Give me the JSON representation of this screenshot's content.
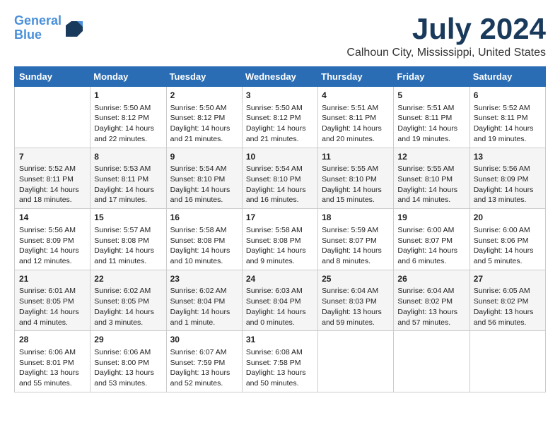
{
  "header": {
    "logo_line1": "General",
    "logo_line2": "Blue",
    "month_title": "July 2024",
    "location": "Calhoun City, Mississippi, United States"
  },
  "weekdays": [
    "Sunday",
    "Monday",
    "Tuesday",
    "Wednesday",
    "Thursday",
    "Friday",
    "Saturday"
  ],
  "weeks": [
    [
      {
        "day": "",
        "sunrise": "",
        "sunset": "",
        "daylight": ""
      },
      {
        "day": "1",
        "sunrise": "Sunrise: 5:50 AM",
        "sunset": "Sunset: 8:12 PM",
        "daylight": "Daylight: 14 hours and 22 minutes."
      },
      {
        "day": "2",
        "sunrise": "Sunrise: 5:50 AM",
        "sunset": "Sunset: 8:12 PM",
        "daylight": "Daylight: 14 hours and 21 minutes."
      },
      {
        "day": "3",
        "sunrise": "Sunrise: 5:50 AM",
        "sunset": "Sunset: 8:12 PM",
        "daylight": "Daylight: 14 hours and 21 minutes."
      },
      {
        "day": "4",
        "sunrise": "Sunrise: 5:51 AM",
        "sunset": "Sunset: 8:11 PM",
        "daylight": "Daylight: 14 hours and 20 minutes."
      },
      {
        "day": "5",
        "sunrise": "Sunrise: 5:51 AM",
        "sunset": "Sunset: 8:11 PM",
        "daylight": "Daylight: 14 hours and 19 minutes."
      },
      {
        "day": "6",
        "sunrise": "Sunrise: 5:52 AM",
        "sunset": "Sunset: 8:11 PM",
        "daylight": "Daylight: 14 hours and 19 minutes."
      }
    ],
    [
      {
        "day": "7",
        "sunrise": "Sunrise: 5:52 AM",
        "sunset": "Sunset: 8:11 PM",
        "daylight": "Daylight: 14 hours and 18 minutes."
      },
      {
        "day": "8",
        "sunrise": "Sunrise: 5:53 AM",
        "sunset": "Sunset: 8:11 PM",
        "daylight": "Daylight: 14 hours and 17 minutes."
      },
      {
        "day": "9",
        "sunrise": "Sunrise: 5:54 AM",
        "sunset": "Sunset: 8:10 PM",
        "daylight": "Daylight: 14 hours and 16 minutes."
      },
      {
        "day": "10",
        "sunrise": "Sunrise: 5:54 AM",
        "sunset": "Sunset: 8:10 PM",
        "daylight": "Daylight: 14 hours and 16 minutes."
      },
      {
        "day": "11",
        "sunrise": "Sunrise: 5:55 AM",
        "sunset": "Sunset: 8:10 PM",
        "daylight": "Daylight: 14 hours and 15 minutes."
      },
      {
        "day": "12",
        "sunrise": "Sunrise: 5:55 AM",
        "sunset": "Sunset: 8:10 PM",
        "daylight": "Daylight: 14 hours and 14 minutes."
      },
      {
        "day": "13",
        "sunrise": "Sunrise: 5:56 AM",
        "sunset": "Sunset: 8:09 PM",
        "daylight": "Daylight: 14 hours and 13 minutes."
      }
    ],
    [
      {
        "day": "14",
        "sunrise": "Sunrise: 5:56 AM",
        "sunset": "Sunset: 8:09 PM",
        "daylight": "Daylight: 14 hours and 12 minutes."
      },
      {
        "day": "15",
        "sunrise": "Sunrise: 5:57 AM",
        "sunset": "Sunset: 8:08 PM",
        "daylight": "Daylight: 14 hours and 11 minutes."
      },
      {
        "day": "16",
        "sunrise": "Sunrise: 5:58 AM",
        "sunset": "Sunset: 8:08 PM",
        "daylight": "Daylight: 14 hours and 10 minutes."
      },
      {
        "day": "17",
        "sunrise": "Sunrise: 5:58 AM",
        "sunset": "Sunset: 8:08 PM",
        "daylight": "Daylight: 14 hours and 9 minutes."
      },
      {
        "day": "18",
        "sunrise": "Sunrise: 5:59 AM",
        "sunset": "Sunset: 8:07 PM",
        "daylight": "Daylight: 14 hours and 8 minutes."
      },
      {
        "day": "19",
        "sunrise": "Sunrise: 6:00 AM",
        "sunset": "Sunset: 8:07 PM",
        "daylight": "Daylight: 14 hours and 6 minutes."
      },
      {
        "day": "20",
        "sunrise": "Sunrise: 6:00 AM",
        "sunset": "Sunset: 8:06 PM",
        "daylight": "Daylight: 14 hours and 5 minutes."
      }
    ],
    [
      {
        "day": "21",
        "sunrise": "Sunrise: 6:01 AM",
        "sunset": "Sunset: 8:05 PM",
        "daylight": "Daylight: 14 hours and 4 minutes."
      },
      {
        "day": "22",
        "sunrise": "Sunrise: 6:02 AM",
        "sunset": "Sunset: 8:05 PM",
        "daylight": "Daylight: 14 hours and 3 minutes."
      },
      {
        "day": "23",
        "sunrise": "Sunrise: 6:02 AM",
        "sunset": "Sunset: 8:04 PM",
        "daylight": "Daylight: 14 hours and 1 minute."
      },
      {
        "day": "24",
        "sunrise": "Sunrise: 6:03 AM",
        "sunset": "Sunset: 8:04 PM",
        "daylight": "Daylight: 14 hours and 0 minutes."
      },
      {
        "day": "25",
        "sunrise": "Sunrise: 6:04 AM",
        "sunset": "Sunset: 8:03 PM",
        "daylight": "Daylight: 13 hours and 59 minutes."
      },
      {
        "day": "26",
        "sunrise": "Sunrise: 6:04 AM",
        "sunset": "Sunset: 8:02 PM",
        "daylight": "Daylight: 13 hours and 57 minutes."
      },
      {
        "day": "27",
        "sunrise": "Sunrise: 6:05 AM",
        "sunset": "Sunset: 8:02 PM",
        "daylight": "Daylight: 13 hours and 56 minutes."
      }
    ],
    [
      {
        "day": "28",
        "sunrise": "Sunrise: 6:06 AM",
        "sunset": "Sunset: 8:01 PM",
        "daylight": "Daylight: 13 hours and 55 minutes."
      },
      {
        "day": "29",
        "sunrise": "Sunrise: 6:06 AM",
        "sunset": "Sunset: 8:00 PM",
        "daylight": "Daylight: 13 hours and 53 minutes."
      },
      {
        "day": "30",
        "sunrise": "Sunrise: 6:07 AM",
        "sunset": "Sunset: 7:59 PM",
        "daylight": "Daylight: 13 hours and 52 minutes."
      },
      {
        "day": "31",
        "sunrise": "Sunrise: 6:08 AM",
        "sunset": "Sunset: 7:58 PM",
        "daylight": "Daylight: 13 hours and 50 minutes."
      },
      {
        "day": "",
        "sunrise": "",
        "sunset": "",
        "daylight": ""
      },
      {
        "day": "",
        "sunrise": "",
        "sunset": "",
        "daylight": ""
      },
      {
        "day": "",
        "sunrise": "",
        "sunset": "",
        "daylight": ""
      }
    ]
  ]
}
